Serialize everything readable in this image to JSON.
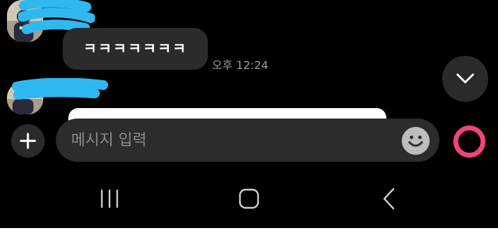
{
  "chat": {
    "message_text": "ㅋㅋㅋㅋㅋㅋㅋ",
    "message_time": "오후 12:24"
  },
  "composer": {
    "placeholder": "메시지 입력"
  },
  "colors": {
    "background": "#000000",
    "bubble": "#2b2b2b",
    "mic_accent": "#f0437c",
    "scribble": "#2fb8f0"
  },
  "icons": {
    "attach": "plus-icon",
    "emoji": "smiley-icon",
    "scroll": "chevron-down-icon",
    "mic": "mic-ring-icon",
    "nav": [
      "recent-apps-icon",
      "home-icon",
      "back-icon"
    ]
  }
}
